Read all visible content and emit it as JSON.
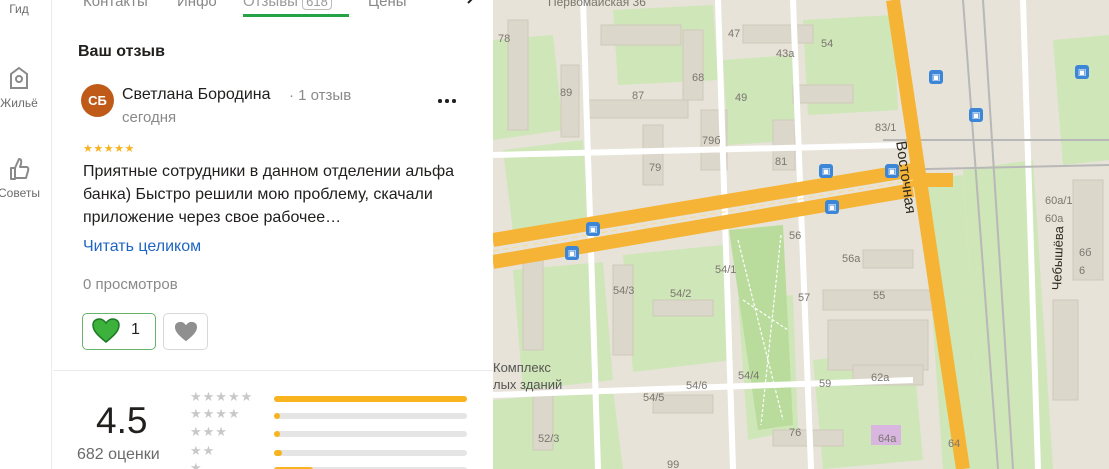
{
  "rail": {
    "items": [
      {
        "label": "Гид",
        "icon": "guide-icon"
      },
      {
        "label": "Жильё",
        "icon": "housing-icon"
      },
      {
        "label": "Советы",
        "icon": "thumb-icon"
      }
    ]
  },
  "tabs": [
    {
      "label": "Контакты"
    },
    {
      "label": "Инфо"
    },
    {
      "label": "Отзывы",
      "count": "618"
    },
    {
      "label": "Цены"
    }
  ],
  "review": {
    "section_title": "Ваш отзыв",
    "avatar_initials": "СБ",
    "author": "Светлана Бородина",
    "author_reviews": "· 1 отзыв",
    "date": "сегодня",
    "stars": "★★★★★",
    "text": "Приятные сотрудники в данном отделении альфа банка) Быстро решили мою проблему, скачали приложение через свое рабочее…",
    "read_more": "Читать целиком",
    "views": "0 просмотров",
    "likes": "1"
  },
  "rating": {
    "value": "4.5",
    "count_label": "682 оценки",
    "distribution": [
      {
        "stars": "★★★★★",
        "fraction": 1.0
      },
      {
        "stars": "★★★★",
        "fraction": 0.03
      },
      {
        "stars": "★★★",
        "fraction": 0.03
      },
      {
        "stars": "★★",
        "fraction": 0.04
      },
      {
        "stars": "★",
        "fraction": 0.2
      }
    ]
  },
  "map": {
    "streets": [
      {
        "name": "Первомайская 36"
      },
      {
        "name": "Восточная"
      },
      {
        "name": "Чебышёва"
      }
    ],
    "poi": [
      {
        "name": "Комплекс"
      },
      {
        "name": "лых зданий"
      }
    ],
    "house_numbers": [
      "78",
      "89",
      "87",
      "68",
      "47",
      "49",
      "43а",
      "54",
      "83/1",
      "79б",
      "79",
      "81",
      "56",
      "56а",
      "54/1",
      "54/3",
      "54/2",
      "57",
      "55",
      "54/6",
      "54/4",
      "54/5",
      "59",
      "62а",
      "76",
      "64а",
      "52/3",
      "99",
      "64",
      "60а/1",
      "60а",
      "6б",
      "6"
    ],
    "colors": {
      "road_major": "#f6b436",
      "green": "#cfe6b8",
      "block": "#e3ded3",
      "background": "#ede9df",
      "metro": "#3c86d8",
      "rating_star": "#f8b31f",
      "link": "#1f66c2",
      "accent_green": "#26a344"
    }
  }
}
